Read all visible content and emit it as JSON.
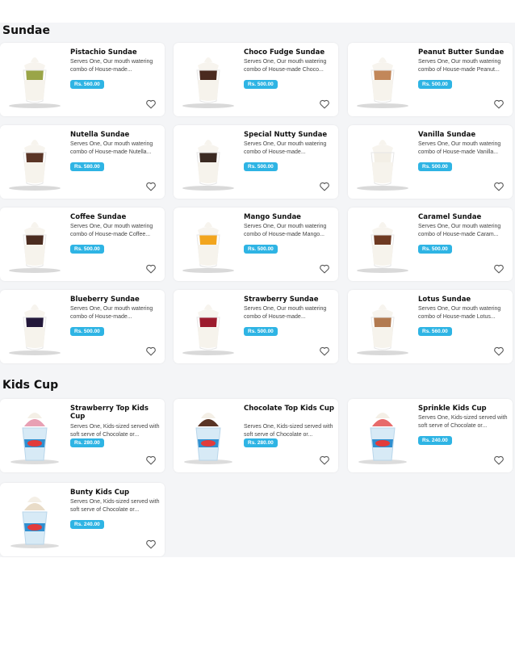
{
  "sections": [
    {
      "title": "Sundae",
      "items": [
        {
          "name": "Pistachio Sundae",
          "desc": "Serves One, Our mouth watering combo of House-made...",
          "price": "Rs. 560.00",
          "topping": "#9aa548",
          "cup": "#ffffff"
        },
        {
          "name": "Choco Fudge Sundae",
          "desc": "Serves One, Our mouth watering combo of House-made Choco...",
          "price": "Rs. 500.00",
          "topping": "#4a2a1f",
          "cup": "#ffffff"
        },
        {
          "name": "Peanut Butter Sundae",
          "desc": "Serves One, Our mouth watering combo of House-made Peanut...",
          "price": "Rs. 500.00",
          "topping": "#c2875a",
          "cup": "#ffffff"
        },
        {
          "name": "Nutella Sundae",
          "desc": "Serves One, Our mouth watering combo of House-made Nutella...",
          "price": "Rs. 580.00",
          "topping": "#5a3526",
          "cup": "#ffffff"
        },
        {
          "name": "Special Nutty Sundae",
          "desc": "Serves One, Our mouth watering combo of House-made...",
          "price": "Rs. 500.00",
          "topping": "#3b2a22",
          "cup": "#ffffff"
        },
        {
          "name": "Vanilla Sundae",
          "desc": "Serves One, Our mouth watering combo of House-made Vanilla...",
          "price": "Rs. 500.00",
          "topping": "#f3efe6",
          "cup": "#ffffff"
        },
        {
          "name": "Coffee Sundae",
          "desc": "Serves One, Our mouth watering combo of House-made Coffee...",
          "price": "Rs. 500.00",
          "topping": "#4b2c20",
          "cup": "#ffffff"
        },
        {
          "name": "Mango Sundae",
          "desc": "Serves One, Our mouth watering combo of House-made Mango...",
          "price": "Rs. 500.00",
          "topping": "#f2a51e",
          "cup": "#ffffff"
        },
        {
          "name": "Caramel Sundae",
          "desc": "Serves One, Our mouth watering combo of House-made Caram...",
          "price": "Rs. 500.00",
          "topping": "#6e3a22",
          "cup": "#ffffff"
        },
        {
          "name": "Blueberry Sundae",
          "desc": "Serves One, Our mouth watering combo of House-made...",
          "price": "Rs. 500.00",
          "topping": "#23183a",
          "cup": "#ffffff"
        },
        {
          "name": "Strawberry Sundae",
          "desc": "Serves One, Our mouth watering combo of House-made...",
          "price": "Rs. 500.00",
          "topping": "#9c1c2e",
          "cup": "#ffffff"
        },
        {
          "name": "Lotus Sundae",
          "desc": "Serves One, Our mouth watering combo of House-made Lotus...",
          "price": "Rs. 560.00",
          "topping": "#b27a50",
          "cup": "#ffffff"
        }
      ]
    },
    {
      "title": "Kids Cup",
      "items": [
        {
          "name": "Strawberry Top Kids Cup",
          "desc": "Serves One, Kids-sized served with soft serve of Chocolate or...",
          "price": "Rs. 280.00",
          "topping": "#e8a0b4",
          "cup": "#d7eaf6"
        },
        {
          "name": "Chocolate Top Kids Cup",
          "desc": "Serves One, Kids-sized served with soft serve of Chocolate or...",
          "price": "Rs. 280.00",
          "topping": "#5a3526",
          "cup": "#d7eaf6"
        },
        {
          "name": "Sprinkle Kids Cup",
          "desc": "Serves One, Kids-sized served with soft serve of Chocolate or...",
          "price": "Rs. 240.00",
          "topping": "#e76b6b",
          "cup": "#d7eaf6"
        },
        {
          "name": "Bunty Kids Cup",
          "desc": "Serves One, Kids-sized served with soft serve of Chocolate or...",
          "price": "Rs. 240.00",
          "topping": "#e9dcc8",
          "cup": "#d7eaf6"
        }
      ]
    }
  ],
  "colors": {
    "price_badge": "#2eb4e4",
    "heart": "#555555",
    "panel_bg": "#f4f5f7"
  },
  "icons": {
    "favorite": "heart-icon"
  }
}
